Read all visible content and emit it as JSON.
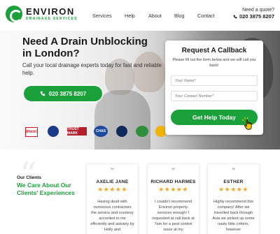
{
  "header": {
    "logo_name": "ENVIRON",
    "logo_sub": "DRAINAGE SERVICES",
    "nav": [
      "Services",
      "Help",
      "About",
      "Blog",
      "Contact"
    ],
    "quote_label": "Need a quote?",
    "quote_phone": "020 3875 8207"
  },
  "hero": {
    "title": "Need A Drain Unblocking in London?",
    "subtitle": "Call your local drainage experts today for fast and reliable help.",
    "call_button": "020 3875 8207",
    "badges": [
      "Which?",
      "",
      "TRUST MARK",
      "CHAS",
      "",
      "",
      ""
    ]
  },
  "callback": {
    "title": "Request A Callback",
    "subtitle": "Please fill out the form below and we will call you back!",
    "name_placeholder": "Your Name*",
    "number_placeholder": "Your Contact Number*",
    "submit": "Get Help Today"
  },
  "clients": {
    "label": "Our Clients",
    "title": "We Care About Our Clients' Experiences",
    "reviews": [
      {
        "name": "AXELIE JANE",
        "stars": "★★★★★",
        "text": "Having dealt with numerous contractors the service and courtesy accorded to me efficiently and astutely by Holly and"
      },
      {
        "name": "RICHARD HARMES",
        "stars": "★★★★★",
        "text": "I couldn't recommend Environ property services enough! I requested at call back at 7am for a pest control issue at my"
      },
      {
        "name": "ESTHER",
        "stars": "★★★★★",
        "text": "Highly recommend this company! After we travelled back through Asia we picked up some nasty little critters, however"
      }
    ]
  },
  "colors": {
    "brand_green": "#1aa13a",
    "star": "#f5a623"
  }
}
